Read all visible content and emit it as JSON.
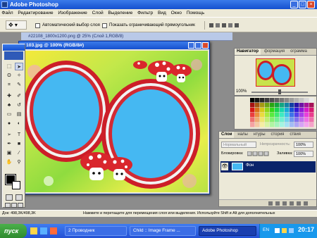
{
  "app": {
    "title": "Adobe Photoshop",
    "colors": {
      "titlebar": "#1f5fdb",
      "chrome": "#ece9d8",
      "workspace": "#8c8c8c",
      "canvas_blue": "#45b8f2",
      "frame_red": "#cc1e28"
    }
  },
  "menu": [
    "Файл",
    "Редактирование",
    "Изображение",
    "Слой",
    "Выделение",
    "Фильтр",
    "Вид",
    "Окно",
    "Помощь"
  ],
  "options": {
    "auto_select_label": "Автоматический выбор слоя",
    "show_bounds_label": "Показать ограничивающий прямоугольник"
  },
  "back_document": {
    "title": "#22108_1800x1200.png @ 25% (Слой 1,RGB/8)"
  },
  "document": {
    "title": "103.jpg @ 100% (RGB/8#)"
  },
  "navigator": {
    "tabs": [
      "Навигатор",
      "формация",
      "ограмма"
    ],
    "zoom": "100%"
  },
  "layers": {
    "tabs": [
      "Слои",
      "налы",
      "нтуры",
      "стория",
      "ствия"
    ],
    "opacity_label": "Непрозрачность:",
    "opacity_value": "100%",
    "blend_mode": "Нормальный",
    "lock_label": "Блокировка:",
    "fill_label": "Заливка:",
    "fill_value": "100%",
    "layer_name": "Фон"
  },
  "status": {
    "doc": "Док: 498,3K/498,3K",
    "hint": "Нажмите и перетащите для перемещения слоя или выделения. Используйте Shift и Alt для дополнительных"
  },
  "taskbar": {
    "start": "пуск",
    "items": [
      "2 Проводник",
      "Child :: Image Frame ...",
      "Adobe Photoshop"
    ],
    "lang": "EN",
    "clock": "20:17"
  },
  "icons": [
    "photoshop-icon",
    "move-icon",
    "marquee-icon",
    "lasso-icon",
    "crop-icon",
    "brush-icon",
    "eraser-icon",
    "type-icon",
    "hand-icon",
    "zoom-icon",
    "eye-icon"
  ]
}
